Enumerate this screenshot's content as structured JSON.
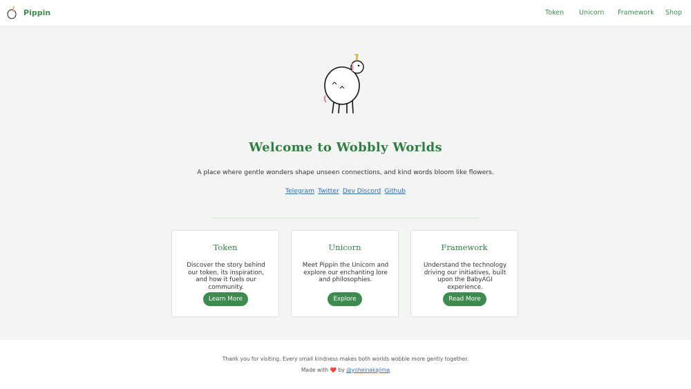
{
  "brand": {
    "name": "Pippin",
    "icon": "unicorn-logo-icon"
  },
  "nav": [
    "Token",
    "Unicorn",
    "Framework",
    "Shop"
  ],
  "hero": {
    "illustration": "pippin-unicorn-illustration",
    "title": "Welcome to Wobbly Worlds",
    "tagline": "A place where gentle wonders shape unseen connections, and kind words bloom like flowers."
  },
  "social": [
    "Telegram",
    "Twitter",
    "Dev Discord",
    "Github"
  ],
  "cards": [
    {
      "title": "Token",
      "description": "Discover the story behind our token, its inspiration, and how it fuels our community.",
      "button": "Learn More"
    },
    {
      "title": "Unicorn",
      "description": "Meet Pippin the Unicorn and explore our enchanting lore and philosophies.",
      "button": "Explore"
    },
    {
      "title": "Framework",
      "description": "Understand the technology driving our initiatives, built upon the BabyAGI experience.",
      "button": "Read More"
    }
  ],
  "footer": {
    "note": "Thank you for visiting. Every small kindness makes both worlds wobble more gently together.",
    "made_with": "Made with",
    "heart": "❤️",
    "by": "by",
    "author": "@yoheinakajima"
  },
  "colors": {
    "accent": "#3f8a4e",
    "link": "#2c6fb5",
    "background": "#f2f5f2"
  }
}
